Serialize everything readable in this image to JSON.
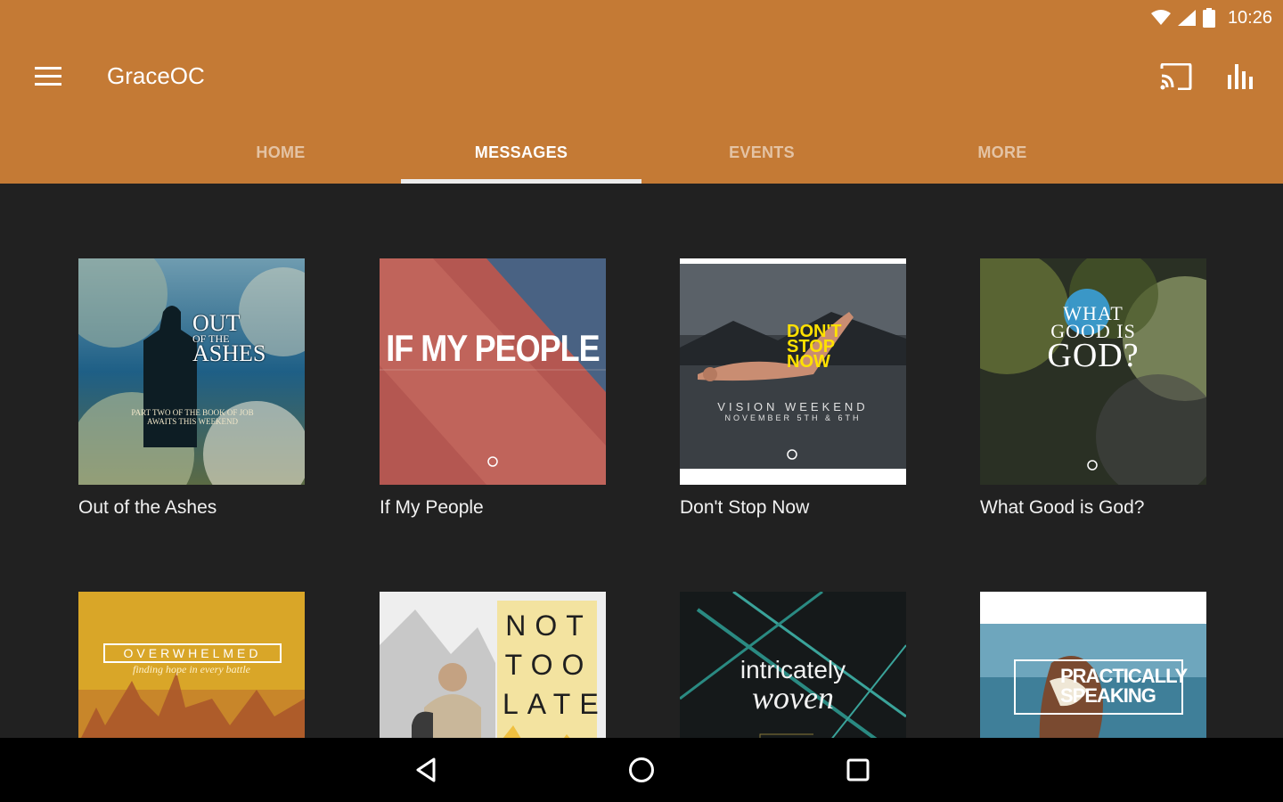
{
  "status_bar": {
    "time": "10:26"
  },
  "app": {
    "title": "GraceOC"
  },
  "tabs": [
    {
      "label": "HOME"
    },
    {
      "label": "MESSAGES"
    },
    {
      "label": "EVENTS"
    },
    {
      "label": "MORE"
    }
  ],
  "messages": [
    {
      "title": "Out of the Ashes",
      "art": {
        "line1": "OUT",
        "line2": "OF THE",
        "line3": "ASHES",
        "sub": "PART TWO OF THE BOOK OF JOB",
        "sub2": "AWAITS THIS WEEKEND"
      }
    },
    {
      "title": "If My People",
      "art": {
        "line1": "IF MY PEOPLE"
      }
    },
    {
      "title": "Don't Stop Now",
      "art": {
        "line1": "DON'T",
        "line2": "STOP",
        "line3": "NOW",
        "sub": "VISION WEEKEND",
        "sub2": "NOVEMBER 5TH & 6TH"
      }
    },
    {
      "title": "What Good is God?",
      "art": {
        "line1": "WHAT",
        "line2": "GOOD IS",
        "line3": "GOD?"
      }
    },
    {
      "title": "",
      "art": {
        "line1": "OVERWHELMED",
        "sub": "finding hope in every battle"
      }
    },
    {
      "title": "",
      "art": {
        "line1": "NOT",
        "line2": "TOO",
        "line3": "LATE"
      }
    },
    {
      "title": "",
      "art": {
        "line1": "intricately",
        "line2": "woven"
      }
    },
    {
      "title": "",
      "art": {
        "line1": "PRACTICALLY",
        "line2": "SPEAKING"
      }
    }
  ],
  "colors": {
    "appbar": "#c47a35",
    "background": "#212121",
    "navbar": "#000000"
  },
  "icons": [
    "menu-icon",
    "cast-icon",
    "chart-icon",
    "wifi-icon",
    "signal-icon",
    "battery-icon",
    "back-icon",
    "home-icon",
    "recents-icon"
  ]
}
